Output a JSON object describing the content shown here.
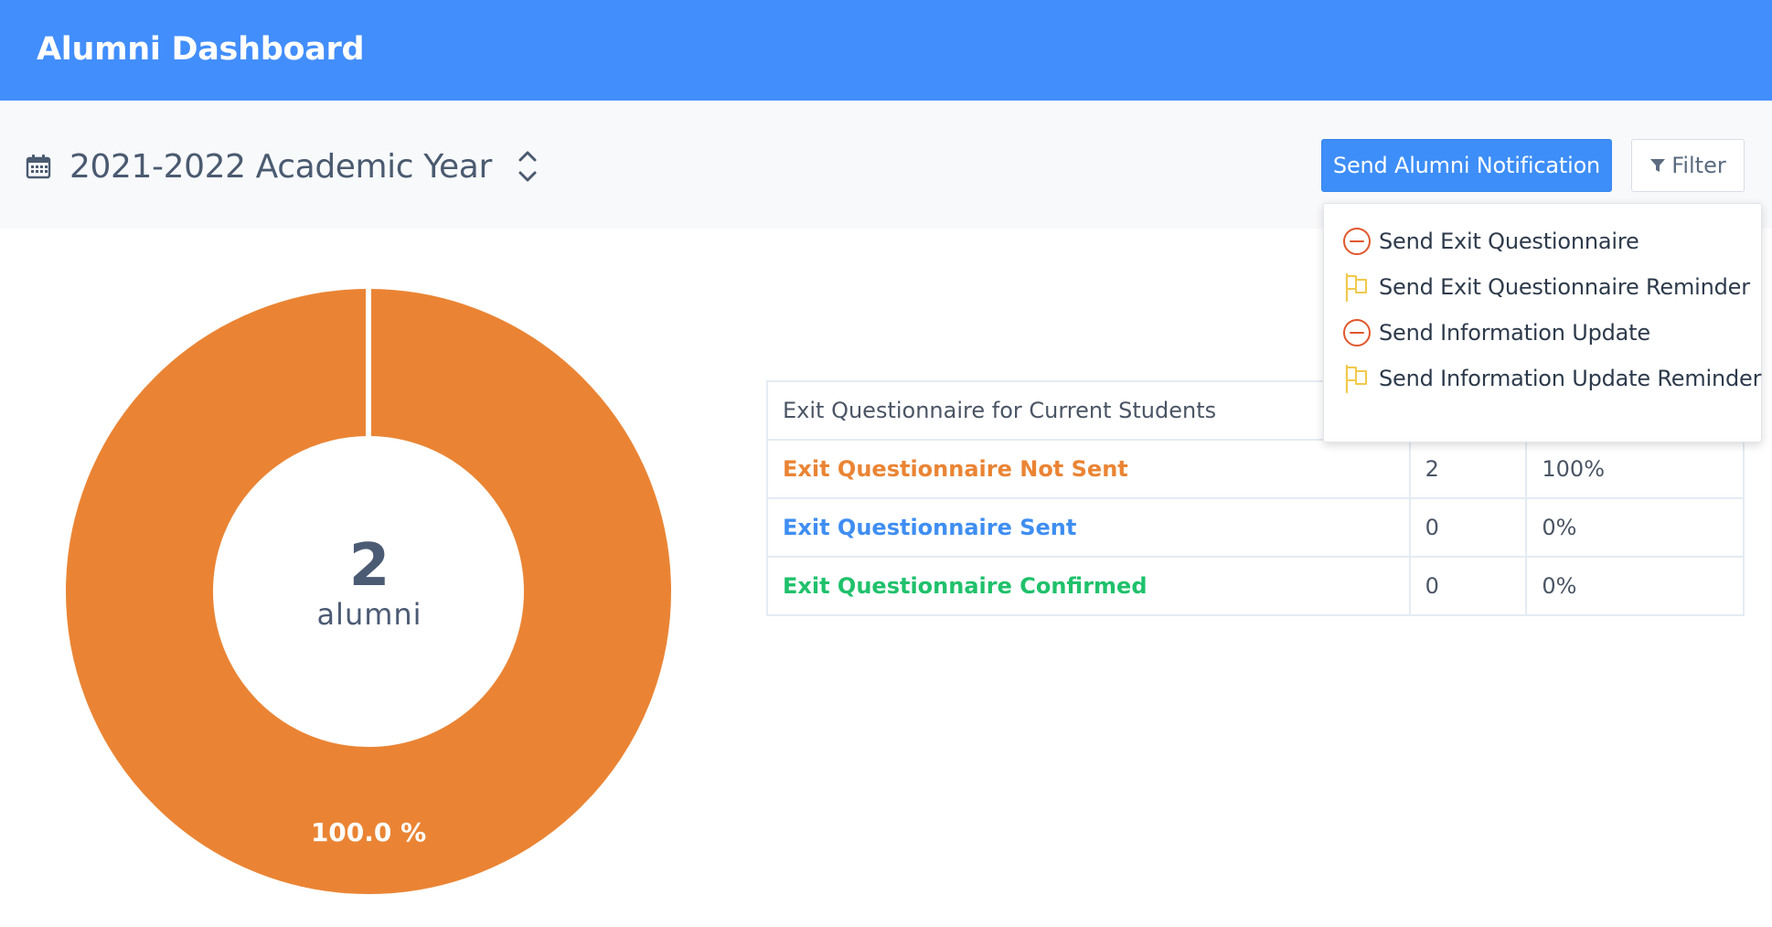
{
  "header": {
    "title": "Alumni Dashboard"
  },
  "toolbar": {
    "year_label": "2021-2022 Academic Year",
    "notify_button": "Send Alumni Notification",
    "filter_button": "Filter"
  },
  "dropdown": {
    "items": [
      {
        "label": "Send Exit Questionnaire",
        "icon": "minus-circle-icon"
      },
      {
        "label": "Send Exit Questionnaire Reminder",
        "icon": "flag-icon"
      },
      {
        "label": "Send Information Update",
        "icon": "minus-circle-icon"
      },
      {
        "label": "Send Information Update Reminder",
        "icon": "flag-icon"
      }
    ]
  },
  "donut": {
    "count": "2",
    "unit": "alumni",
    "percent_label": "100.0 %"
  },
  "table": {
    "header": "Exit Questionnaire for Current Students",
    "rows": [
      {
        "label": "Exit Questionnaire Not Sent",
        "count": "2",
        "percent": "100%"
      },
      {
        "label": "Exit Questionnaire Sent",
        "count": "0",
        "percent": "0%"
      },
      {
        "label": "Exit Questionnaire Confirmed",
        "count": "0",
        "percent": "0%"
      }
    ]
  },
  "colors": {
    "header_bg": "#428efd",
    "primary_button": "#3d8ef8",
    "not_sent": "#ea8434",
    "sent": "#3f8ef2",
    "confirmed": "#1fc16b",
    "icon_red": "#e0572c",
    "icon_yellow": "#f2c94c"
  },
  "chart_data": {
    "type": "pie",
    "categories": [
      "Exit Questionnaire Not Sent",
      "Exit Questionnaire Sent",
      "Exit Questionnaire Confirmed"
    ],
    "values": [
      2,
      0,
      0
    ],
    "colors": [
      "#ea8434",
      "#3f8ef2",
      "#1fc16b"
    ]
  }
}
